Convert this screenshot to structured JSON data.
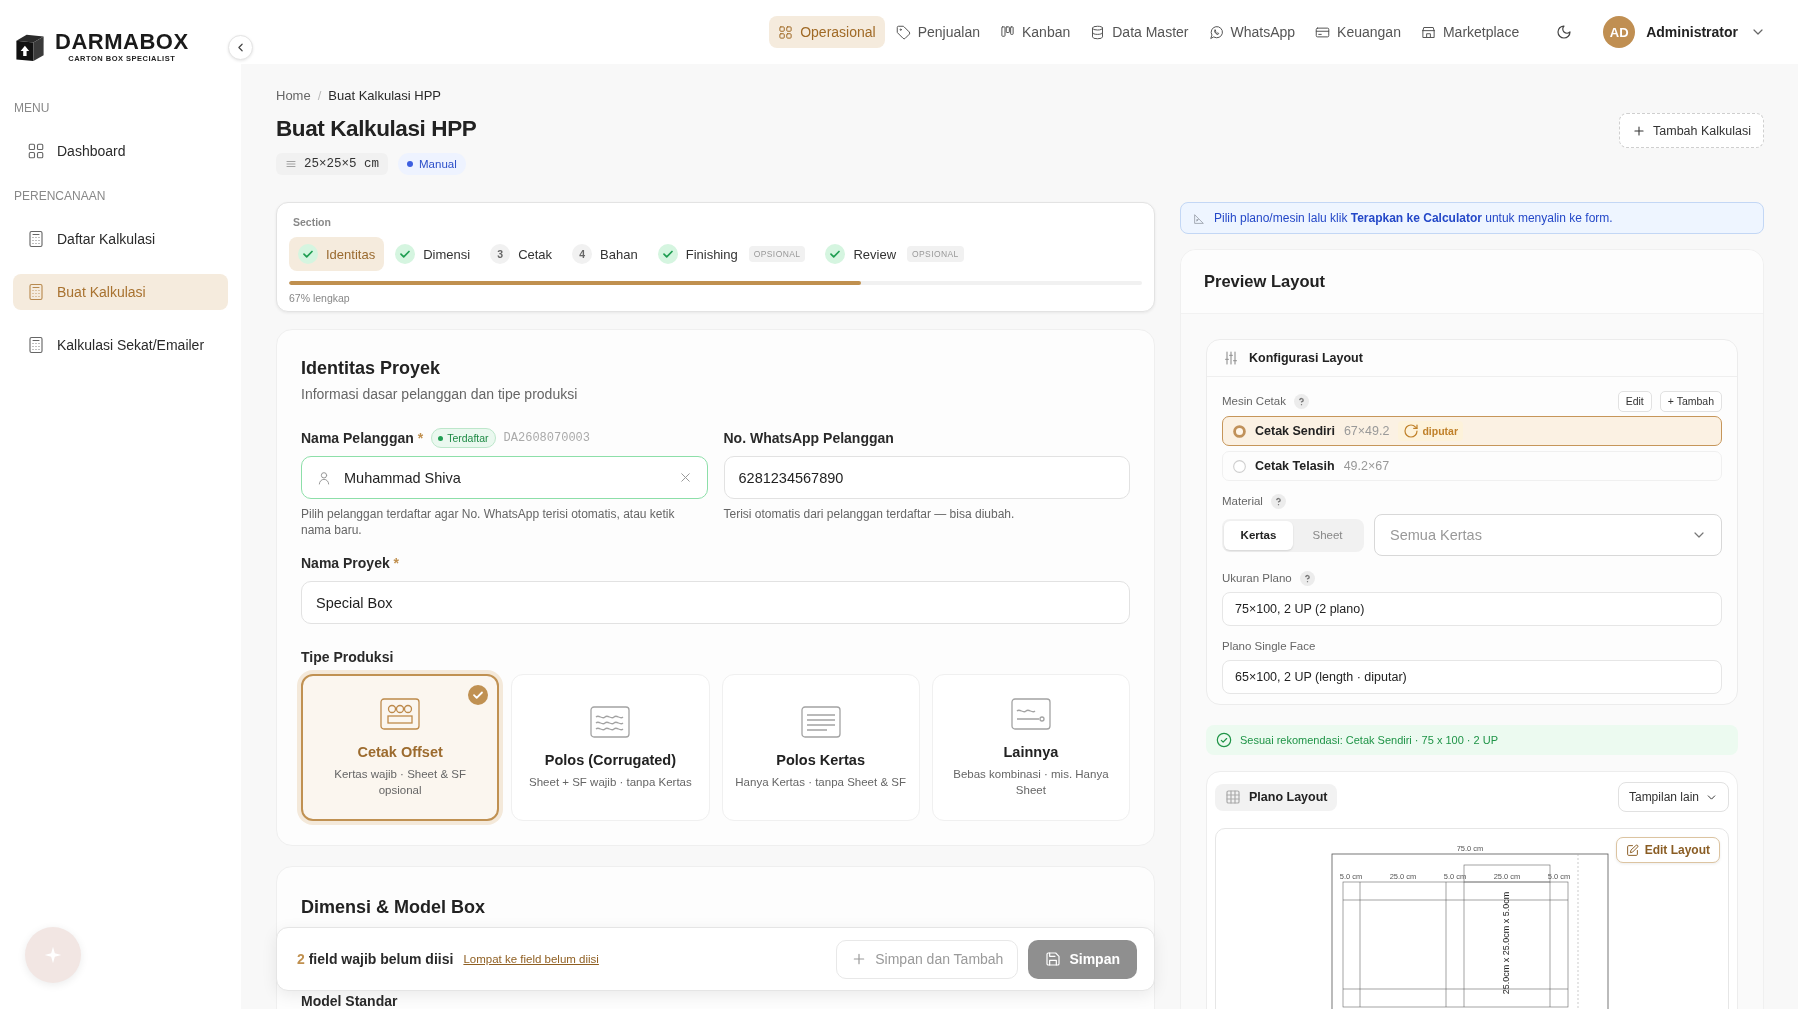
{
  "brand": {
    "name": "DARMABOX",
    "tagline": "CARTON BOX SPECIALIST"
  },
  "sidebar": {
    "sections": [
      {
        "heading": "MENU",
        "items": [
          {
            "label": "Dashboard",
            "kind": "dashboard",
            "selected": false
          }
        ]
      },
      {
        "heading": "PERENCANAAN",
        "items": [
          {
            "label": "Daftar Kalkulasi",
            "kind": "calculator",
            "selected": false
          },
          {
            "label": "Buat Kalkulasi",
            "kind": "calculator",
            "selected": true
          },
          {
            "label": "Kalkulasi Sekat/Emailer",
            "kind": "calculator",
            "selected": false
          }
        ]
      }
    ]
  },
  "nav": {
    "items": [
      {
        "label": "Operasional",
        "kind": "grid",
        "selected": true
      },
      {
        "label": "Penjualan",
        "kind": "tag",
        "selected": false
      },
      {
        "label": "Kanban",
        "kind": "kanban",
        "selected": false
      },
      {
        "label": "Data Master",
        "kind": "database",
        "selected": false
      },
      {
        "label": "WhatsApp",
        "kind": "chat",
        "selected": false
      },
      {
        "label": "Keuangan",
        "kind": "card",
        "selected": false
      },
      {
        "label": "Marketplace",
        "kind": "store",
        "selected": false
      }
    ],
    "user": {
      "initials": "AD",
      "name": "Administrator"
    }
  },
  "page": {
    "breadcrumb": [
      "Home",
      "Buat Kalkulasi HPP"
    ],
    "breadcrumb_separator": "/",
    "title": "Buat Kalkulasi HPP",
    "dimensions": "25×25×5 cm",
    "mode_badge": "Manual",
    "add_button": "Tambah Kalkulasi"
  },
  "stepper": {
    "heading": "Section",
    "steps": [
      {
        "label": "Identitas",
        "done": true,
        "selected": true
      },
      {
        "label": "Dimensi",
        "done": true,
        "selected": false
      },
      {
        "label": "Cetak",
        "number": "3",
        "done": false,
        "selected": false
      },
      {
        "label": "Bahan",
        "number": "4",
        "done": false,
        "selected": false
      },
      {
        "label": "Finishing",
        "done": true,
        "selected": false,
        "badge": "OPSIONAL"
      },
      {
        "label": "Review",
        "done": true,
        "selected": false,
        "badge": "OPSIONAL"
      }
    ],
    "level": 0.67,
    "progress_text": "67% lengkap"
  },
  "identitas": {
    "title": "Identitas Proyek",
    "subtitle": "Informasi dasar pelanggan dan tipe produksi",
    "customer": {
      "label": "Nama Pelanggan",
      "required_mark": "*",
      "status_badge": "Terdaftar",
      "code": "DA2608070003",
      "value": "Muhammad Shiva",
      "valid": true,
      "help": "Pilih pelanggan terdaftar agar No. WhatsApp terisi otomatis, atau ketik nama baru."
    },
    "whatsapp": {
      "label": "No. WhatsApp Pelanggan",
      "value": "6281234567890",
      "help": "Terisi otomatis dari pelanggan terdaftar — bisa diubah."
    },
    "project": {
      "label": "Nama Proyek",
      "required_mark": "*",
      "value": "Special Box"
    },
    "production_type": {
      "label": "Tipe Produksi",
      "options": [
        {
          "kind": "offset",
          "title": "Cetak Offset",
          "description": "Kertas wajib · Sheet & SF opsional",
          "selected": true
        },
        {
          "kind": "corrugated",
          "title": "Polos (Corrugated)",
          "description": "Sheet + SF wajib · tanpa Kertas",
          "selected": false
        },
        {
          "kind": "paper",
          "title": "Polos Kertas",
          "description": "Hanya Kertas · tanpa Sheet & SF",
          "selected": false
        },
        {
          "kind": "other",
          "title": "Lainnya",
          "description": "Bebas kombinasi · mis. Hanya Sheet",
          "selected": false
        }
      ]
    }
  },
  "dimensi": {
    "title": "Dimensi & Model Box",
    "model_label": "Model Standar"
  },
  "save_bar": {
    "missing_count": "2",
    "missing_text": "field wajib belum diisi",
    "jump_link": "Lompat ke field belum diisi",
    "save_add_button": {
      "label": "Simpan dan Tambah",
      "disabled": true
    },
    "save_button": {
      "label": "Simpan",
      "disabled": true
    }
  },
  "banner": {
    "text": "Pilih plano/mesin lalu klik **Terapkan ke Calculator** untuk menyalin ke form."
  },
  "preview": {
    "title": "Preview Layout",
    "config": {
      "title": "Konfigurasi Layout",
      "machine": {
        "label": "Mesin Cetak",
        "edit_button": "Edit",
        "add_button": "+ Tambah",
        "options": [
          {
            "name": "Cetak Sendiri",
            "size": "67×49.2",
            "tag": "diputar",
            "selected": true
          },
          {
            "name": "Cetak Telasih",
            "size": "49.2×67",
            "selected": false
          }
        ]
      },
      "material": {
        "label": "Material",
        "tabs": [
          {
            "label": "Kertas",
            "selected": true
          },
          {
            "label": "Sheet",
            "selected": false
          }
        ],
        "select_placeholder": "Semua Kertas"
      },
      "plano_size": {
        "label": "Ukuran Plano",
        "value": "75×100, 2 UP (2 plano)"
      },
      "single_face": {
        "label": "Plano Single Face",
        "value": "65×100, 2 UP (length · diputar)"
      }
    },
    "recommendation": "Sesuai rekomendasi: Cetak Sendiri · 75 x 100 · 2 UP",
    "layout": {
      "tab": "Plano Layout",
      "view_select": "Tampilan lain",
      "edit_button": "Edit Layout",
      "sheet_width_label": "75.0 cm",
      "column_labels": [
        "5.0 cm",
        "25.0 cm",
        "5.0 cm",
        "25.0 cm",
        "5.0 cm"
      ],
      "box_label": "25.0cm x 25.0cm x 5.0cm"
    }
  }
}
